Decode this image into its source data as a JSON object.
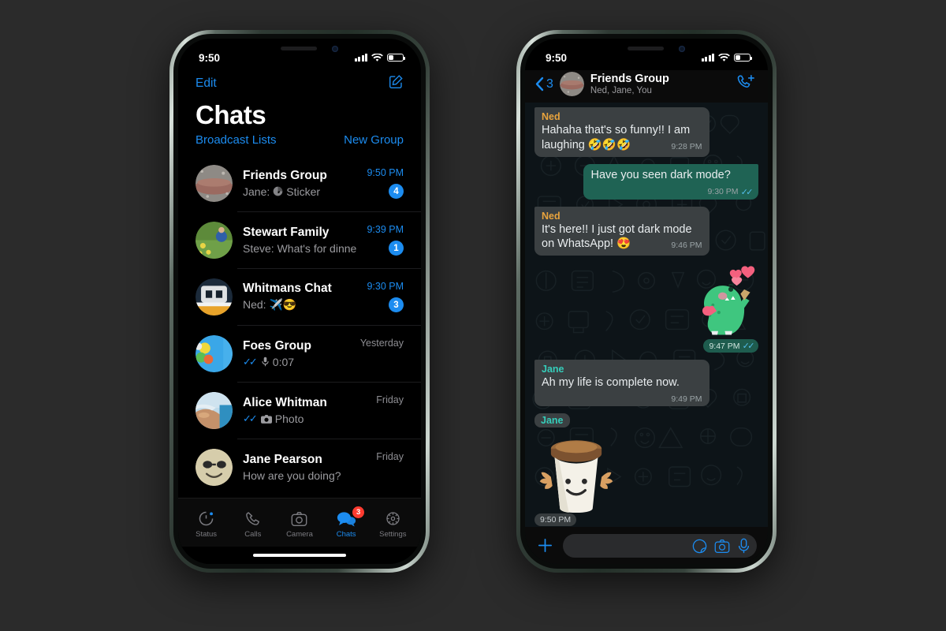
{
  "canvas": {
    "background": "#2b2b2b"
  },
  "theme": {
    "accent_blue": "#1c8cf0",
    "badge_red": "#ff3b30",
    "outgoing_bubble": "#1f6354",
    "incoming_bubble": "#3b4042",
    "sender_ned": "#e8a33d",
    "sender_jane": "#35cdba",
    "tick_blue": "#53bdeb"
  },
  "left_phone": {
    "status_bar": {
      "time": "9:50",
      "signal_icon": "cellular-bars-icon",
      "wifi_icon": "wifi-icon",
      "battery_icon": "battery-icon"
    },
    "nav": {
      "edit_label": "Edit",
      "compose_icon": "compose-icon",
      "title": "Chats",
      "broadcast_label": "Broadcast Lists",
      "new_group_label": "New Group"
    },
    "chats": [
      {
        "name": "Friends Group",
        "preview": "Jane: ",
        "preview_icon": "sticker-icon",
        "preview_tail": "Sticker",
        "time": "9:50 PM",
        "time_style": "blue",
        "badge": "4",
        "ticks": false,
        "avatar": "rocks-beach-avatar"
      },
      {
        "name": "Stewart Family",
        "preview": "Steve: What's for dinner?",
        "preview_icon": "",
        "preview_tail": "",
        "time": "9:39 PM",
        "time_style": "blue",
        "badge": "1",
        "ticks": false,
        "avatar": "garden-avatar"
      },
      {
        "name": "Whitmans Chat",
        "preview": "Ned: ✈️😎",
        "preview_icon": "",
        "preview_tail": "",
        "time": "9:30 PM",
        "time_style": "blue",
        "badge": "3",
        "ticks": false,
        "avatar": "boat-avatar"
      },
      {
        "name": "Foes Group",
        "preview": "",
        "preview_icon": "mic-icon",
        "preview_tail": "0:07",
        "time": "Yesterday",
        "time_style": "grey",
        "badge": "",
        "ticks": true,
        "avatar": "balloons-avatar"
      },
      {
        "name": "Alice Whitman",
        "preview": "",
        "preview_icon": "camera-icon",
        "preview_tail": "Photo",
        "time": "Friday",
        "time_style": "grey",
        "badge": "",
        "ticks": true,
        "avatar": "shore-avatar"
      },
      {
        "name": "Jane Pearson",
        "preview": "How are you doing?",
        "preview_icon": "",
        "preview_tail": "",
        "time": "Friday",
        "time_style": "grey",
        "badge": "",
        "ticks": false,
        "avatar": "sunglasses-emoji-avatar"
      }
    ],
    "tabs": [
      {
        "label": "Status",
        "icon": "status-ring-icon",
        "active": false,
        "badge": ""
      },
      {
        "label": "Calls",
        "icon": "phone-icon",
        "active": false,
        "badge": ""
      },
      {
        "label": "Camera",
        "icon": "camera-icon",
        "active": false,
        "badge": ""
      },
      {
        "label": "Chats",
        "icon": "chat-bubbles-icon",
        "active": true,
        "badge": "3"
      },
      {
        "label": "Settings",
        "icon": "gear-icon",
        "active": false,
        "badge": ""
      }
    ]
  },
  "right_phone": {
    "status_bar": {
      "time": "9:50",
      "signal_icon": "cellular-bars-icon",
      "wifi_icon": "wifi-icon",
      "battery_icon": "battery-icon"
    },
    "conversation_header": {
      "back_icon": "chevron-left-icon",
      "back_count": "3",
      "avatar": "rocks-beach-avatar",
      "title": "Friends Group",
      "subtitle": "Ned, Jane, You",
      "call_icon": "video-call-add-icon"
    },
    "messages": [
      {
        "type": "text",
        "direction": "in",
        "sender": "Ned",
        "sender_color_key": "ned",
        "text": "Hahaha that's so funny!! I am laughing 🤣🤣🤣",
        "time": "9:28 PM",
        "ticks": false
      },
      {
        "type": "text",
        "direction": "out",
        "sender": "",
        "sender_color_key": "",
        "text": "Have you seen dark mode?",
        "time": "9:30 PM",
        "ticks": true
      },
      {
        "type": "text",
        "direction": "in",
        "sender": "Ned",
        "sender_color_key": "ned",
        "text": "It's here!! I just got dark mode on WhatsApp! 😍",
        "time": "9:46 PM",
        "ticks": false
      },
      {
        "type": "sticker",
        "direction": "out",
        "sender": "",
        "sender_color_key": "",
        "sticker": "dinosaur-heart-sticker",
        "time": "9:47 PM",
        "ticks": true
      },
      {
        "type": "text",
        "direction": "in",
        "sender": "Jane",
        "sender_color_key": "jane",
        "text": "Ah my life is complete now.",
        "time": "9:49 PM",
        "ticks": false
      },
      {
        "type": "sticker",
        "direction": "in",
        "sender": "Jane",
        "sender_color_key": "jane",
        "sticker": "coffee-cup-sticker",
        "time": "9:50 PM",
        "ticks": false
      }
    ],
    "composer": {
      "plus_icon": "plus-icon",
      "input_value": "",
      "input_placeholder": "",
      "sticker_icon": "sticker-icon",
      "camera_icon": "camera-icon",
      "mic_icon": "mic-icon"
    }
  }
}
